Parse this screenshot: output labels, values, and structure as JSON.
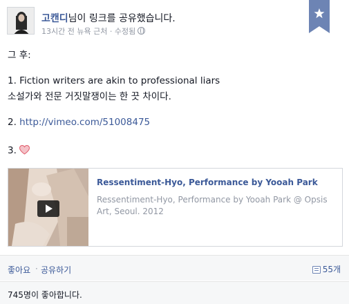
{
  "header": {
    "author_name": "고캔디",
    "action_text": "님이 링크를 공유했습니다.",
    "timestamp": "13시간 전 뉴욕 근처",
    "separator": " · ",
    "edited_label": "수정됨",
    "privacy_icon": "globe-icon"
  },
  "bookmark": {
    "icon": "star-icon",
    "color": "#6d84b4"
  },
  "body": {
    "line1": "그 후:",
    "line2": "1. Fiction writers are akin to professional liars",
    "line3": "소설가와 전문 거짓말쟁이는 한 끗 차이다.",
    "line4_prefix": "2. ",
    "line4_link": "http://vimeo.com/51008475",
    "line5": "3.",
    "heart_icon": "heart-icon",
    "heart_color": "#e05a6a"
  },
  "link_card": {
    "title": "Ressentiment-Hyo, Performance by Yooah Park",
    "description": "Ressentiment-Hyo, Performance by Yooah Park @ Opsis Art, Seoul. 2012",
    "play_icon": "play-icon"
  },
  "actions": {
    "like_label": "좋아요",
    "separator": "·",
    "share_label": "공유하기",
    "comment_count": "55개",
    "comment_icon": "comment-icon"
  },
  "likes": {
    "summary": "745명이 좋아합니다."
  },
  "colors": {
    "link": "#3b5998",
    "meta": "#9197a3",
    "text": "#141823",
    "footer_bg": "#f6f7f8"
  }
}
